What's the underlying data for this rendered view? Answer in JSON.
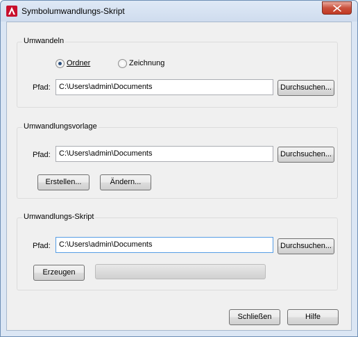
{
  "window": {
    "title": "Symbolumwandlungs-Skript"
  },
  "convert": {
    "legend": "Umwandeln",
    "options": [
      {
        "label": "Ordner",
        "checked": true
      },
      {
        "label": "Zeichnung",
        "checked": false
      }
    ],
    "path_label": "Pfad:",
    "path_value": "C:\\Users\\admin\\Documents",
    "browse_label": "Durchsuchen..."
  },
  "template": {
    "legend": "Umwandlungsvorlage",
    "path_label": "Pfad:",
    "path_value": "C:\\Users\\admin\\Documents",
    "browse_label": "Durchsuchen...",
    "create_label": "Erstellen...",
    "modify_label": "Ändern..."
  },
  "script": {
    "legend": "Umwandlungs-Skript",
    "path_label": "Pfad:",
    "path_value": "C:\\Users\\admin\\Documents",
    "browse_label": "Durchsuchen...",
    "generate_label": "Erzeugen",
    "progress": 0
  },
  "footer": {
    "close_label": "Schließen",
    "help_label": "Hilfe"
  }
}
